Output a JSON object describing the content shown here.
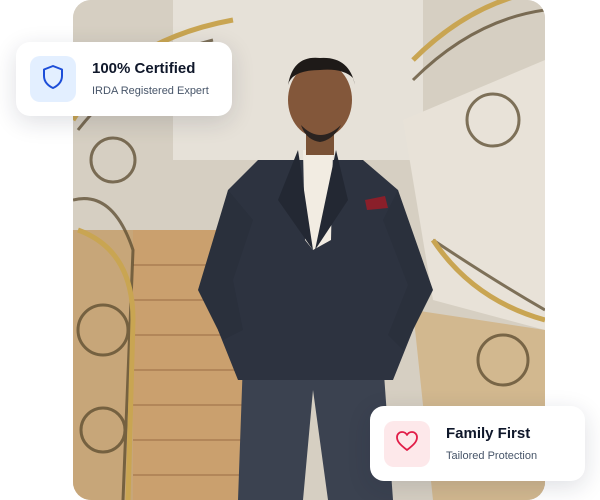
{
  "cards": {
    "certified": {
      "title": "100% Certified",
      "subtitle": "IRDA Registered Expert",
      "icon": "shield-icon",
      "icon_color": "#1d4ed8",
      "icon_bg": "#e3efff"
    },
    "family": {
      "title": "Family First",
      "subtitle": "Tailored Protection",
      "icon": "heart-icon",
      "icon_color": "#e11d48",
      "icon_bg": "#fde8ea"
    }
  },
  "photo": {
    "subject": "man-in-suit-on-staircase"
  }
}
